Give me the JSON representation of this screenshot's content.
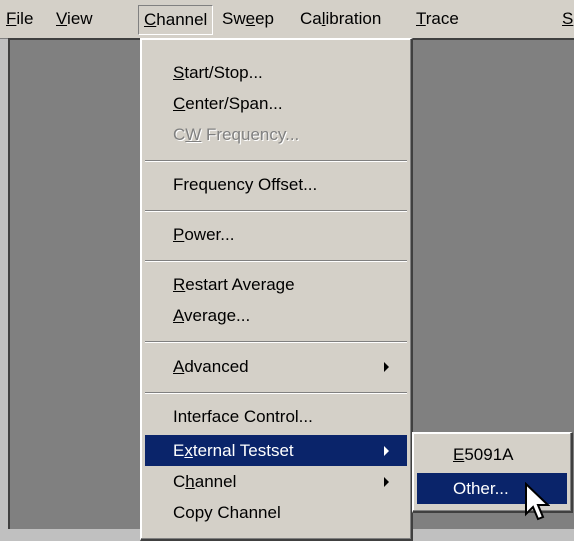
{
  "menubar": {
    "items": [
      {
        "label": "File",
        "mnemonic": "F",
        "rest": "ile"
      },
      {
        "label": "View",
        "mnemonic": "V",
        "rest": "iew"
      },
      {
        "label": "Channel",
        "mnemonic": "C",
        "rest": "hannel"
      },
      {
        "label": "Sweep",
        "pre": "Sw",
        "mnemonic": "e",
        "rest": "ep"
      },
      {
        "label": "Calibration",
        "pre": "Ca",
        "mnemonic": "l",
        "rest": "ibration"
      },
      {
        "label": "Trace",
        "mnemonic": "T",
        "rest": "race"
      },
      {
        "label": "S",
        "mnemonic": "S",
        "rest": ""
      }
    ],
    "open_menu": "Channel"
  },
  "channel_menu": {
    "items": [
      {
        "label": "Start/Stop...",
        "mnemonic": "S",
        "rest": "tart/Stop..."
      },
      {
        "label": "Center/Span...",
        "mnemonic": "C",
        "rest": "enter/Span..."
      },
      {
        "label": "CW Frequency...",
        "pre": "C",
        "mnemonic": "W",
        "rest": " Frequency...",
        "disabled": true
      },
      {
        "label": "Frequency Offset..."
      },
      {
        "label": "Power...",
        "mnemonic": "P",
        "rest": "ower..."
      },
      {
        "label": "Restart Average",
        "mnemonic": "R",
        "rest": "estart Average"
      },
      {
        "label": "Average...",
        "mnemonic": "A",
        "rest": "verage..."
      },
      {
        "label": "Advanced",
        "mnemonic": "A",
        "rest": "dvanced",
        "submenu": true
      },
      {
        "label": "Interface Control..."
      },
      {
        "label": "External Testset",
        "pre": "E",
        "mnemonic": "x",
        "rest": "ternal Testset",
        "submenu": true,
        "selected": true
      },
      {
        "label": "Channel",
        "pre": "C",
        "mnemonic": "h",
        "rest": "annel",
        "submenu": true
      },
      {
        "label": "Copy Channel"
      }
    ]
  },
  "testset_submenu": {
    "items": [
      {
        "label": "E5091A",
        "mnemonic": "E",
        "rest": "5091A"
      },
      {
        "label": "Other...",
        "selected": true
      }
    ]
  },
  "icons": {
    "submenu_arrow": "triangle-right-icon",
    "cursor": "arrow-pointer-icon"
  },
  "colors": {
    "menu_bg": "#d4d0c8",
    "highlight": "#0a246a",
    "workspace": "#808080"
  }
}
